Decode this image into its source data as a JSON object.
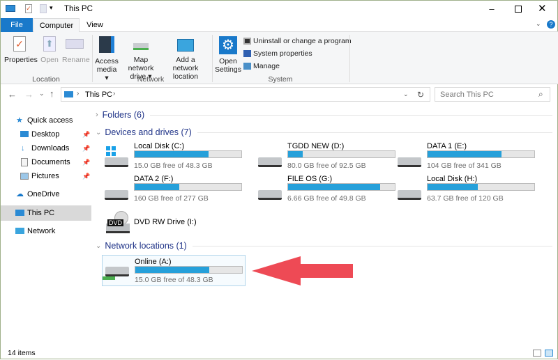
{
  "window": {
    "title": "This PC"
  },
  "ribbon_tabs": [
    {
      "label": "File"
    },
    {
      "label": "Computer"
    },
    {
      "label": "View"
    }
  ],
  "ribbon": {
    "location": {
      "label": "Location",
      "buttons": [
        "Properties",
        "Open",
        "Rename"
      ]
    },
    "network": {
      "label": "Network",
      "access_media": [
        "Access",
        "media"
      ],
      "map_drive": [
        "Map network",
        "drive"
      ],
      "add_location": [
        "Add a network",
        "location"
      ]
    },
    "system": {
      "label": "System",
      "open_settings": [
        "Open",
        "Settings"
      ],
      "uninstall": "Uninstall or change a program",
      "sys_props": "System properties",
      "manage": "Manage"
    }
  },
  "address": {
    "path": "This PC",
    "search_placeholder": "Search This PC"
  },
  "nav": [
    {
      "label": "Quick access"
    },
    {
      "label": "Desktop"
    },
    {
      "label": "Downloads"
    },
    {
      "label": "Documents"
    },
    {
      "label": "Pictures"
    },
    {
      "label": "OneDrive"
    },
    {
      "label": "This PC"
    },
    {
      "label": "Network"
    }
  ],
  "sections": {
    "folders": "Folders (6)",
    "devices": "Devices and drives (7)",
    "network": "Network locations (1)"
  },
  "drives": [
    {
      "name": "Local Disk (C:)",
      "free": "15.0 GB free of 48.3 GB",
      "used_pct": 69,
      "icon": "windows-drive"
    },
    {
      "name": "TGDD NEW (D:)",
      "free": "80.0 GB free of 92.5 GB",
      "used_pct": 13.5,
      "icon": "hdd"
    },
    {
      "name": "DATA 1 (E:)",
      "free": "104 GB free of 341 GB",
      "used_pct": 69.5,
      "icon": "hdd"
    },
    {
      "name": "DATA 2 (F:)",
      "free": "160 GB free of 277 GB",
      "used_pct": 42,
      "icon": "hdd"
    },
    {
      "name": "FILE OS (G:)",
      "free": "6.66 GB free of 49.8 GB",
      "used_pct": 86.6,
      "icon": "hdd"
    },
    {
      "name": "Local Disk (H:)",
      "free": "63.7 GB free of 120 GB",
      "used_pct": 47,
      "icon": "hdd"
    }
  ],
  "dvd": {
    "name": "DVD RW Drive (I:)",
    "badge": "DVD"
  },
  "network_drive": {
    "name": "Online (A:)",
    "free": "15.0 GB free of 48.3 GB",
    "used_pct": 69
  },
  "status": {
    "items": "14 items"
  },
  "colors": {
    "accent": "#1979ca",
    "bar": "#26a0da",
    "arrow": "#ee4a55"
  }
}
